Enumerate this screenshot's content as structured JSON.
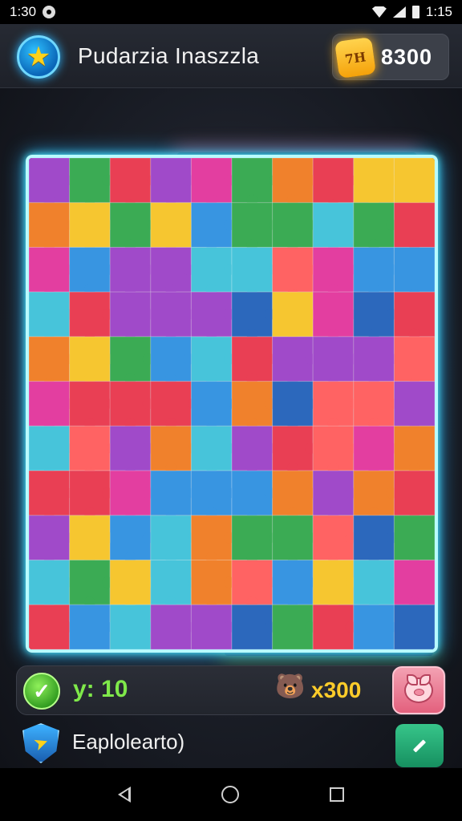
{
  "status_bar": {
    "time": "1:30",
    "battery_text": "1:15",
    "icons": [
      "notification-icon",
      "wifi-icon",
      "signal-icon",
      "battery-icon"
    ]
  },
  "header": {
    "title": "Pudarzia Inaszzla",
    "coin_badge": "7H",
    "coin_value": "8300",
    "icons": [
      "star-icon",
      "coin-icon"
    ]
  },
  "board": {
    "rows": 11,
    "cols": 10,
    "palette": [
      "#e8334a",
      "#f6c324",
      "#2fa64a",
      "#2c8fe0",
      "#9b3fc6",
      "#f07a1f",
      "#e2329b",
      "#3cc1d8",
      "#1f5fb8",
      "#ff5a5a"
    ],
    "frame_color": "#b8fbff"
  },
  "score_bar": {
    "moves_label": "y:",
    "moves_value": "10",
    "multiplier": "x300",
    "icons": [
      "check-icon",
      "bear-icon",
      "piggy-bank-icon"
    ]
  },
  "bottom": {
    "label": "Eaplolearto)",
    "icons": [
      "shield-icon",
      "edit-icon"
    ]
  },
  "nav": {
    "icons": [
      "back-icon",
      "home-icon",
      "recents-icon"
    ]
  }
}
